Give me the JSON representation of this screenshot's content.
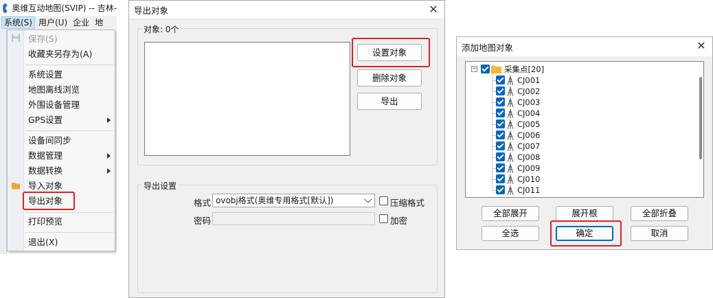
{
  "app": {
    "title": "奥维互动地图(SVIP) -- 吉林-",
    "menubar": [
      "系统(S)",
      "用户(U)",
      "企业",
      "地"
    ]
  },
  "menu": {
    "items": [
      {
        "label": "保存(S)",
        "disabled": true
      },
      {
        "label": "收藏夹另存为(A)"
      },
      {
        "label": "系统设置"
      },
      {
        "label": "地图离线浏览"
      },
      {
        "label": "外围设备管理"
      },
      {
        "label": "GPS设置",
        "submenu": true
      },
      {
        "label": "设备间同步"
      },
      {
        "label": "数据管理",
        "submenu": true
      },
      {
        "label": "数据转换",
        "submenu": true
      },
      {
        "label": "导入对象"
      },
      {
        "label": "导出对象"
      },
      {
        "label": "打印预览"
      },
      {
        "label": "退出(X)"
      }
    ]
  },
  "export_dialog": {
    "title": "导出对象",
    "objects_label": "对象: 0个",
    "buttons": {
      "set": "设置对象",
      "delete": "删除对象",
      "export": "导出"
    },
    "settings_label": "导出设置",
    "format_label": "格式",
    "format_value": "ovobj格式(奥维专用格式[默认])",
    "compress_label": "压缩格式",
    "password_label": "密码",
    "encrypt_label": "加密"
  },
  "add_dialog": {
    "title": "添加地图对象",
    "root_label": "采集点[20]",
    "items": [
      "CJ001",
      "CJ002",
      "CJ003",
      "CJ004",
      "CJ005",
      "CJ006",
      "CJ007",
      "CJ008",
      "CJ009",
      "CJ010",
      "CJ011"
    ],
    "buttons": {
      "expand_all": "全部展开",
      "expand_root": "展开根",
      "collapse_all": "全部折叠",
      "select_all": "全选",
      "ok": "确定",
      "cancel": "取消"
    }
  },
  "colors": {
    "accent": "#0067c0",
    "highlight": "#e02020"
  }
}
